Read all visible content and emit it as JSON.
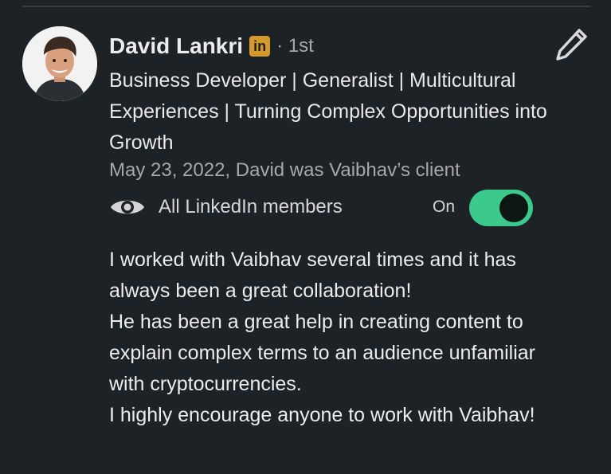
{
  "recommendation": {
    "author_name": "David Lankri",
    "linkedin_badge": "in",
    "degree": "· 1st",
    "headline": "Business Developer | Generalist | Multicultural Experiences | Turning Complex Opportunities into Growth",
    "date_relation": "May 23, 2022, David was Vaibhav’s client",
    "visibility_label": "All LinkedIn members",
    "toggle_state_label": "On",
    "toggle_on": true,
    "body_lines": [
      "I worked with Vaibhav several times and it has always been a great collaboration!",
      "He has been a great help in creating content to explain complex terms to an audience unfamiliar with cryptocurrencies.",
      "I highly encourage anyone to work with Vaibhav!"
    ]
  },
  "icons": {
    "edit": "pencil-icon",
    "visibility": "eye-icon",
    "badge": "linkedin-icon"
  },
  "colors": {
    "background": "#1d2226",
    "toggle_on": "#3cc98c",
    "badge": "#d59a2c",
    "secondary_text": "#a8a8a8"
  }
}
